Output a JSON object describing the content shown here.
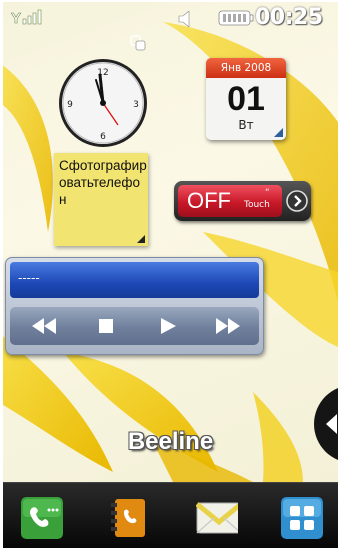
{
  "status_bar": {
    "time": "00:25",
    "icons": [
      "signal-icon",
      "speaker-icon",
      "battery-icon"
    ]
  },
  "widgets": {
    "sync_icon": "sync-icon",
    "clock": {
      "icon": "analog-clock-icon"
    },
    "calendar": {
      "month_year": "Янв 2008",
      "day": "01",
      "weekday": "Вт"
    },
    "note": {
      "text": "Сфотографироватьтелефон"
    },
    "toggle": {
      "state": "OFF",
      "touch_label": "Touch",
      "quote_mark": "“"
    },
    "player": {
      "track": "-----",
      "controls": [
        "rewind",
        "stop",
        "play",
        "fast-forward"
      ]
    }
  },
  "operator": "Beeline",
  "dock": {
    "items": [
      {
        "name": "phone-icon",
        "color": "#3aa03a"
      },
      {
        "name": "contacts-icon",
        "color": "#e08a12"
      },
      {
        "name": "messages-icon",
        "color": "#e8d24a"
      },
      {
        "name": "menu-icon",
        "color": "#2f8fcf"
      }
    ]
  },
  "colors": {
    "calendar_header": "#dd4422",
    "toggle_red": "#c81828",
    "player_blue": "#1d48b6",
    "wallpaper_yellow": "#f3cf1c"
  }
}
